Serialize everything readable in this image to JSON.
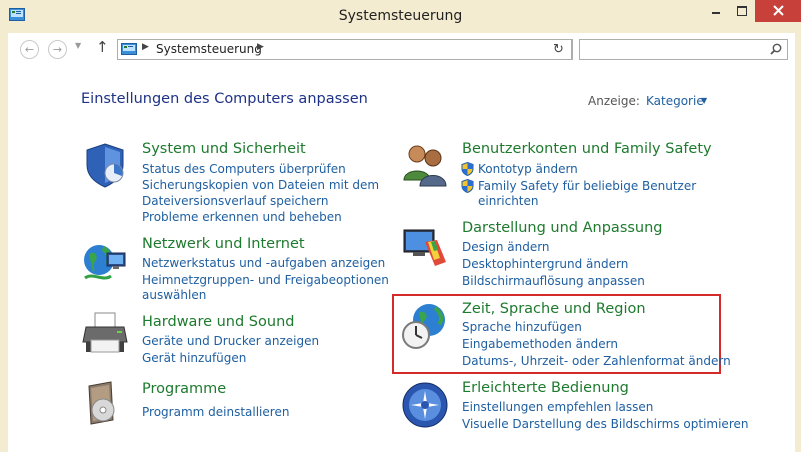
{
  "window": {
    "title": "Systemsteuerung"
  },
  "address": {
    "crumb": "Systemsteuerung",
    "search_placeholder": ""
  },
  "header": {
    "page_title": "Einstellungen des Computers anpassen",
    "view_label": "Anzeige:",
    "view_value": "Kategorie"
  },
  "categories": [
    {
      "title": "System und Sicherheit",
      "icon": "shield-security-icon",
      "links": [
        "Status des Computers überprüfen",
        "Sicherungskopien von Dateien mit dem",
        "Dateiversionsverlauf speichern",
        "Probleme erkennen und beheben"
      ]
    },
    {
      "title": "Netzwerk und Internet",
      "icon": "network-globe-icon",
      "links": [
        "Netzwerkstatus und -aufgaben anzeigen",
        "Heimnetzgruppen- und Freigabeoptionen",
        "auswählen"
      ]
    },
    {
      "title": "Hardware und Sound",
      "icon": "printer-icon",
      "links": [
        "Geräte und Drucker anzeigen",
        "Gerät hinzufügen"
      ]
    },
    {
      "title": "Programme",
      "icon": "programs-disc-icon",
      "links": [
        "Programm deinstallieren"
      ]
    },
    {
      "title": "Benutzerkonten und Family Safety",
      "icon": "users-icon",
      "links": [
        "Kontotyp ändern",
        "Family Safety für beliebige Benutzer",
        "einrichten"
      ]
    },
    {
      "title": "Darstellung und Anpassung",
      "icon": "appearance-monitor-icon",
      "links": [
        "Design ändern",
        "Desktophintergrund ändern",
        "Bildschirmauflösung anpassen"
      ]
    },
    {
      "title": "Zeit, Sprache und Region",
      "icon": "clock-globe-icon",
      "links": [
        "Sprache hinzufügen",
        "Eingabemethoden ändern",
        "Datums-, Uhrzeit- oder Zahlenformat ändern"
      ]
    },
    {
      "title": "Erleichterte Bedienung",
      "icon": "ease-of-access-icon",
      "links": [
        "Einstellungen empfehlen lassen",
        "Visuelle Darstellung des Bildschirms optimieren"
      ]
    }
  ],
  "colors": {
    "titlebar": "#f4ecd0",
    "close_button": "#c7413a",
    "category_title": "#1e7a2e",
    "link": "#1f5fa0",
    "page_title": "#1e3287",
    "highlight_border": "#d42a2a"
  }
}
